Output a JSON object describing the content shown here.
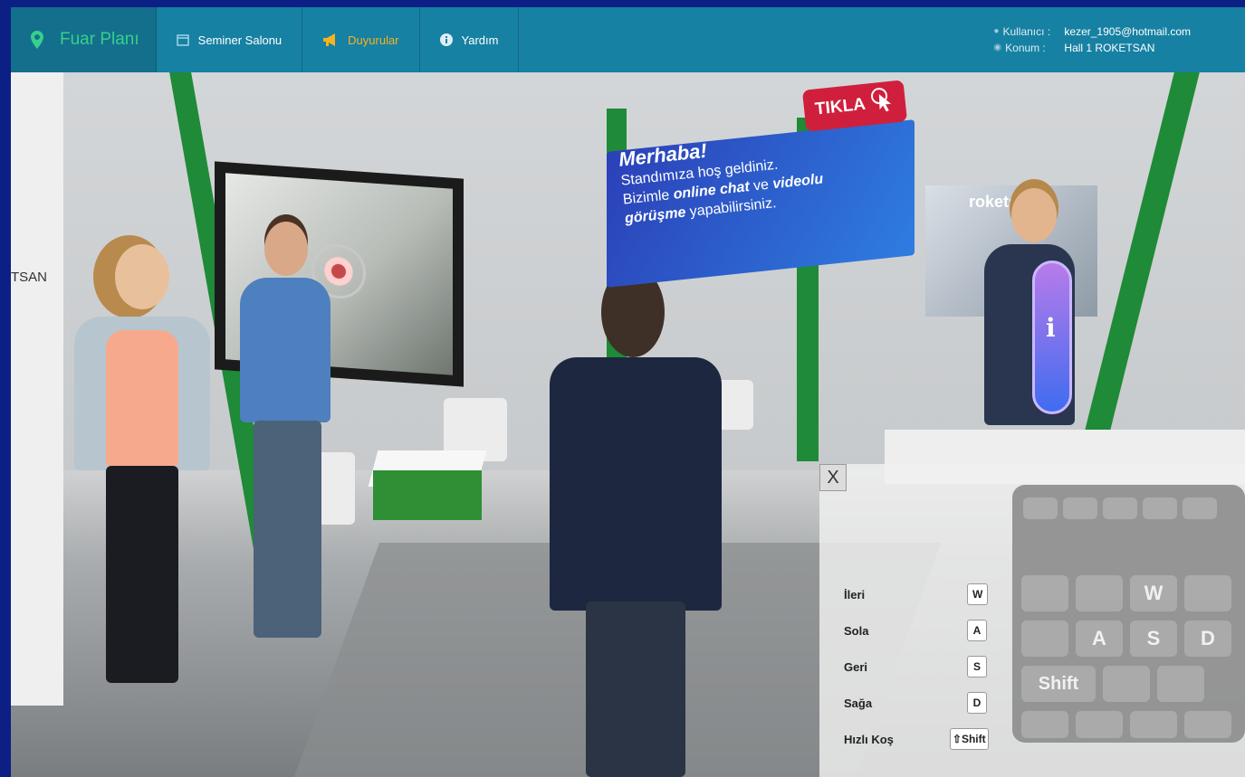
{
  "nav": {
    "brand": "Fuar Planı",
    "items": [
      {
        "label": "Seminer Salonu",
        "icon": "calendar-icon"
      },
      {
        "label": "Duyurular",
        "icon": "megaphone-icon"
      },
      {
        "label": "Yardım",
        "icon": "info-icon"
      }
    ]
  },
  "user": {
    "user_label": "Kullanıcı :",
    "user_value": "kezer_1905@hotmail.com",
    "location_label": "Konum :",
    "location_value": "Hall 1  ROKETSAN"
  },
  "banner": {
    "title": "Merhaba!",
    "line1": "Standımıza hoş geldiniz.",
    "line2_prefix": "Bizimle ",
    "line2_bold1": "online chat",
    "line2_mid": " ve ",
    "line2_bold2": "videolu",
    "line3_bold": "görüşme",
    "line3_suffix": " yapabilirsiniz.",
    "cta": "TIKLA"
  },
  "booth": {
    "poster_brand": "roketsan",
    "side_sign_fragment": "TSAN"
  },
  "help": {
    "close": "X",
    "rows": [
      {
        "label": "İleri",
        "key": "W"
      },
      {
        "label": "Sola",
        "key": "A"
      },
      {
        "label": "Geri",
        "key": "S"
      },
      {
        "label": "Sağa",
        "key": "D"
      },
      {
        "label": "Hızlı Koş",
        "key": "⇧Shift"
      }
    ],
    "keyboard_keys": [
      "W",
      "A",
      "S",
      "D",
      "Shift"
    ]
  },
  "colors": {
    "nav_bg": "#1781a3",
    "brand_green": "#36d08a",
    "announce_orange": "#f6b31d",
    "booth_green": "#1f8a37",
    "banner_blue": "#2e5ad0",
    "cta_red": "#d01f3c"
  }
}
